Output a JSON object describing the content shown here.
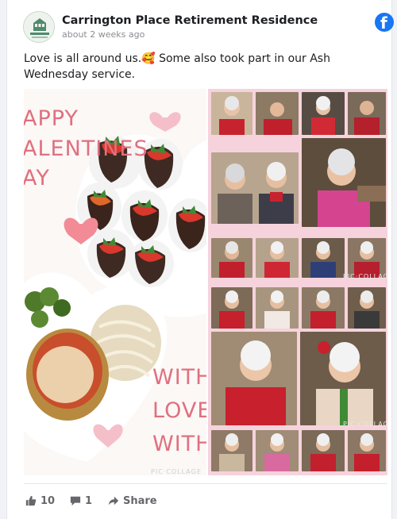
{
  "post": {
    "page_name": "Carrington Place Retirement Residence",
    "timestamp": "about 2 weeks ago",
    "text": "Love is all around us.🥰 Some also took part in our Ash Wednesday service.",
    "avatar_logo_text": "Carrington Place"
  },
  "image": {
    "title_lines": [
      "APPY",
      "ALENTINES",
      "AY"
    ],
    "with_lines": [
      "WITH",
      "LOVE",
      "WITH"
    ],
    "watermark": "PIC·COLLAGE",
    "colors": {
      "pink_text": "#e0707f",
      "collage_background": "#f6d3dc",
      "panel_background": "#fbf8f6"
    }
  },
  "actions": {
    "like_count": "10",
    "comment_count": "1",
    "share_label": "Share"
  },
  "icons": {
    "facebook": "facebook-icon",
    "like": "thumbs-up-icon",
    "comment": "comment-icon",
    "share": "share-arrow-icon"
  }
}
